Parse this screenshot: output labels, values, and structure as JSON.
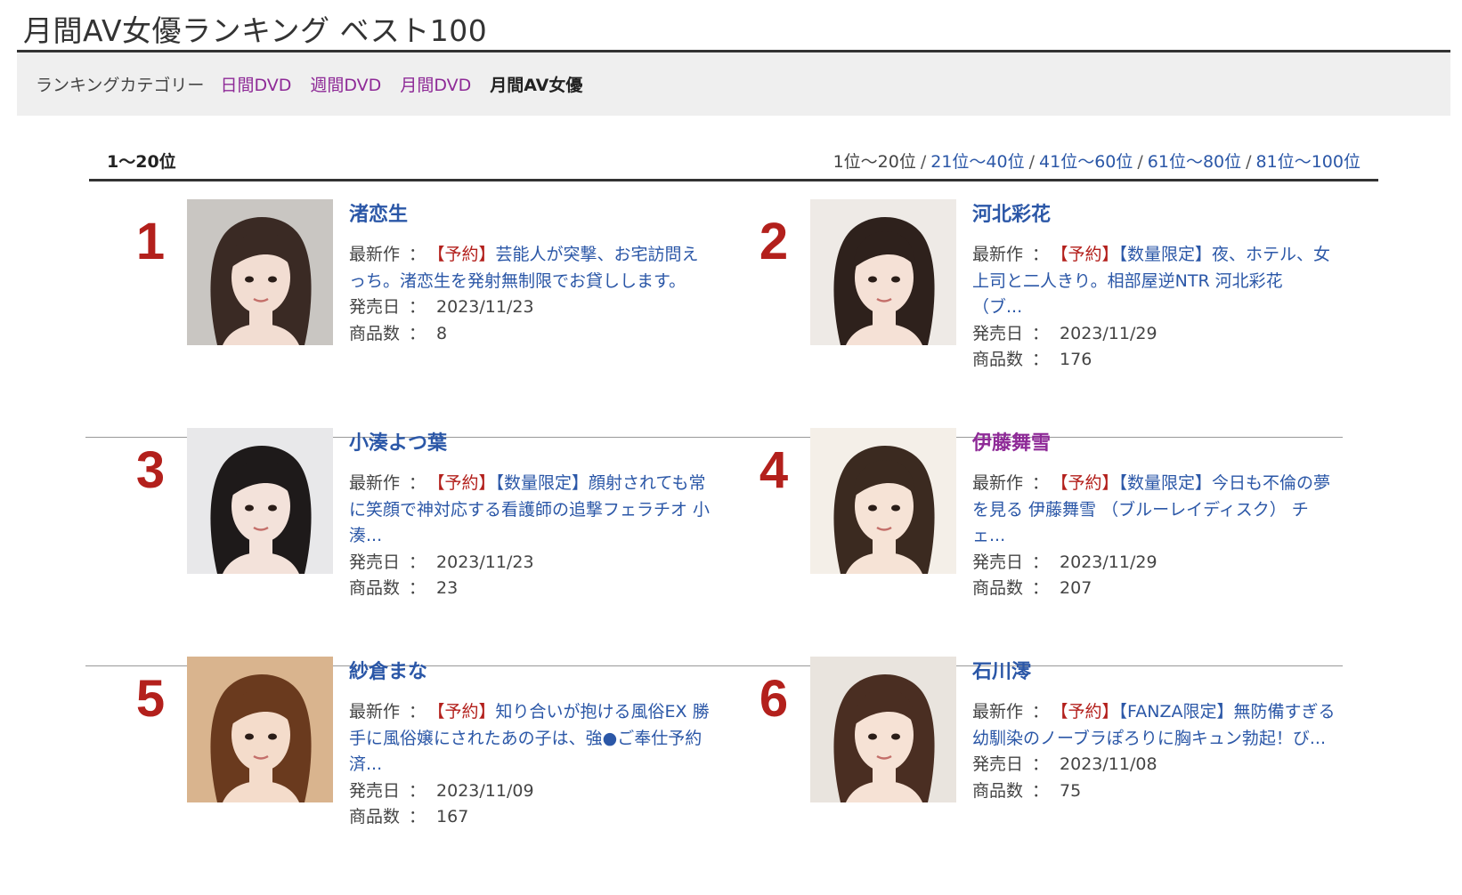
{
  "page": {
    "title": "月間AV女優ランキング ベスト100"
  },
  "category_bar": {
    "label": "ランキングカテゴリー",
    "links": [
      "日間DVD",
      "週間DVD",
      "月間DVD"
    ],
    "current": "月間AV女優"
  },
  "range": {
    "current_label": "1〜20位",
    "pager": {
      "current": "1位〜20位",
      "links": [
        "21位〜40位",
        "41位〜60位",
        "61位〜80位",
        "81位〜100位"
      ],
      "separator": "/"
    }
  },
  "labels": {
    "latest": "最新作",
    "release": "発売日",
    "count": "商品数",
    "colon": "："
  },
  "colors": {
    "accent_link": "#2b57a7",
    "visited_link": "#8e2a97",
    "rank_red": "#b3201c",
    "category_bg": "#efefef"
  },
  "rankings": [
    {
      "rank": "1",
      "name": "渚恋生",
      "visited": false,
      "latest_tag": "【予約】",
      "latest_title": "芸能人が突撃、お宅訪問えっち。渚恋生を発射無制限でお貸しします。",
      "release_date": "2023/11/23",
      "product_count": "8",
      "photo_bg": "#c9c6c2",
      "hair": "#3a2a24",
      "skin": "#f2ddd2"
    },
    {
      "rank": "2",
      "name": "河北彩花",
      "visited": false,
      "latest_tag": "【予約】",
      "latest_title": "【数量限定】夜、ホテル、女上司と二人きり。相部屋逆NTR 河北彩花 （ブ...",
      "release_date": "2023/11/29",
      "product_count": "176",
      "photo_bg": "#eeeae6",
      "hair": "#2e211c",
      "skin": "#f5e1d6"
    },
    {
      "rank": "3",
      "name": "小湊よつ葉",
      "visited": false,
      "latest_tag": "【予約】",
      "latest_title": "【数量限定】顔射されても常に笑顔で神対応する看護師の追撃フェラチオ 小湊...",
      "release_date": "2023/11/23",
      "product_count": "23",
      "photo_bg": "#e8e8ea",
      "hair": "#1e1a1a",
      "skin": "#f3e2da"
    },
    {
      "rank": "4",
      "name": "伊藤舞雪",
      "visited": true,
      "latest_tag": "【予約】",
      "latest_title": "【数量限定】今日も不倫の夢を見る 伊藤舞雪 （ブルーレイディスク） チェ...",
      "release_date": "2023/11/29",
      "product_count": "207",
      "photo_bg": "#f4efe8",
      "hair": "#3b2a20",
      "skin": "#f6e3d6"
    },
    {
      "rank": "5",
      "name": "紗倉まな",
      "visited": false,
      "latest_tag": "【予約】",
      "latest_title": "知り合いが抱ける風俗EX 勝手に風俗嬢にされたあの子は、強●ご奉仕予約済...",
      "release_date": "2023/11/09",
      "product_count": "167",
      "photo_bg": "#d9b48e",
      "hair": "#6a3a1e",
      "skin": "#f4dccb"
    },
    {
      "rank": "6",
      "name": "石川澪",
      "visited": false,
      "latest_tag": "【予約】",
      "latest_title": "【FANZA限定】無防備すぎる幼馴染のノーブラぽろりに胸キュン勃起！び...",
      "release_date": "2023/11/08",
      "product_count": "75",
      "photo_bg": "#e9e4de",
      "hair": "#4a2e22",
      "skin": "#f6e2d5"
    }
  ]
}
